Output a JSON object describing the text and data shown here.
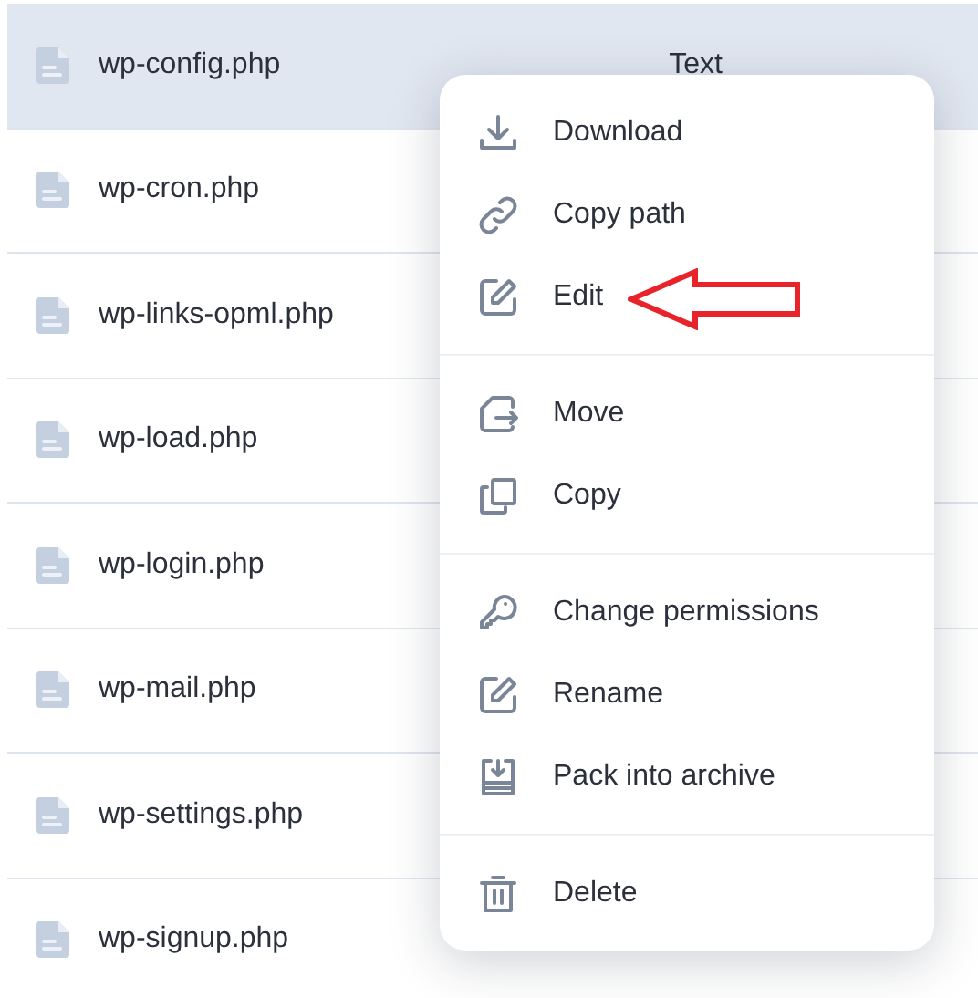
{
  "files": [
    {
      "name": "wp-config.php",
      "column_2": "Text",
      "selected": true
    },
    {
      "name": "wp-cron.php",
      "selected": false
    },
    {
      "name": "wp-links-opml.php",
      "selected": false
    },
    {
      "name": "wp-load.php",
      "selected": false
    },
    {
      "name": "wp-login.php",
      "selected": false
    },
    {
      "name": "wp-mail.php",
      "selected": false
    },
    {
      "name": "wp-settings.php",
      "selected": false
    },
    {
      "name": "wp-signup.php",
      "selected": false
    }
  ],
  "context_menu": {
    "groups": [
      {
        "items": [
          {
            "label": "Download"
          },
          {
            "label": "Copy path"
          },
          {
            "label": "Edit"
          }
        ]
      },
      {
        "items": [
          {
            "label": "Move"
          },
          {
            "label": "Copy"
          }
        ]
      },
      {
        "items": [
          {
            "label": "Change permissions"
          },
          {
            "label": "Rename"
          },
          {
            "label": "Pack into archive"
          }
        ]
      },
      {
        "items": [
          {
            "label": "Delete"
          }
        ]
      }
    ]
  }
}
